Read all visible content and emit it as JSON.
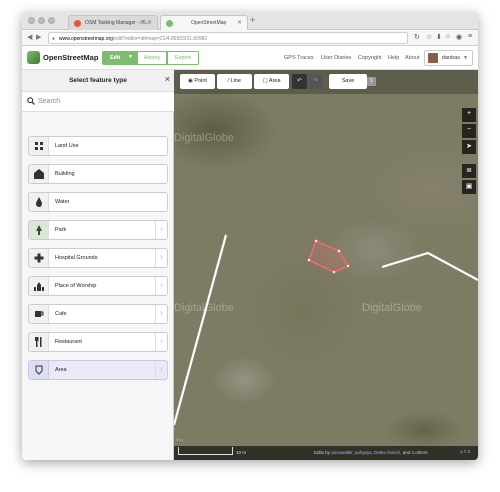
{
  "browser": {
    "tabs": [
      {
        "title": "OSM Tasking Manager - #5...",
        "favicon_color": "#e05a3a"
      },
      {
        "title": "OpenStreetMap",
        "favicon_color": "#7ebc6f"
      }
    ],
    "url_host": "www.openstreetmap.org",
    "url_rest": "/edit?editor=id#map=21/4.86503/31.60982",
    "new_tab": "+"
  },
  "header": {
    "brand": "OpenStreetMap",
    "edit_label": "Edit",
    "history_label": "History",
    "export_label": "Export",
    "links": [
      "GPS Traces",
      "User Diaries",
      "Copyright",
      "Help",
      "About"
    ],
    "username": "danbas"
  },
  "sidebar": {
    "title": "Select feature type",
    "close": "×",
    "search_placeholder": "Search",
    "presets": [
      {
        "label": "Land Use",
        "icon": "land-use-icon",
        "info": false
      },
      {
        "label": "Building",
        "icon": "building-icon",
        "info": false
      },
      {
        "label": "Water",
        "icon": "water-icon",
        "info": false
      },
      {
        "label": "Park",
        "icon": "park-icon",
        "info": true
      },
      {
        "label": "Hospital Grounds",
        "icon": "hospital-icon",
        "info": true
      },
      {
        "label": "Place of Worship",
        "icon": "worship-icon",
        "info": true
      },
      {
        "label": "Cafe",
        "icon": "cafe-icon",
        "info": true
      },
      {
        "label": "Restaurant",
        "icon": "restaurant-icon",
        "info": true
      },
      {
        "label": "Area",
        "icon": "area-icon",
        "info": true,
        "selected": true
      }
    ],
    "info_glyph": "i"
  },
  "map": {
    "point_label": "Point",
    "line_label": "Line",
    "area_label": "Area",
    "save_label": "Save",
    "save_count": "1",
    "watermark": "DigitalGlobe",
    "scale_label": "10 m",
    "attribution_prefix": "Edits by",
    "attribution_users": "aicruwaller, pohysys, Darko Ilovich",
    "attribution_suffix": ", and 4 others",
    "version": "1.7.3",
    "ghost_text": "Bing",
    "controls": [
      "+",
      "−",
      "➤",
      "≣",
      "▣"
    ]
  },
  "colors": {
    "accent": "#7ebc6f",
    "selection": "#e06e6e"
  }
}
